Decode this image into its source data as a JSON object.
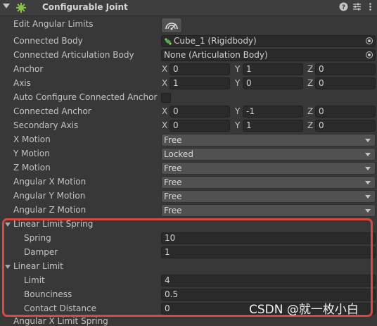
{
  "component": {
    "title": "Configurable Joint",
    "icons": [
      "help-icon",
      "preset-icon",
      "more-options-icon"
    ]
  },
  "rows": {
    "edit_angular_limits": "Edit Angular Limits",
    "connected_body": {
      "label": "Connected Body",
      "value": "Cube_1 (Rigidbody)"
    },
    "connected_articulation_body": {
      "label": "Connected Articulation Body",
      "value": "None (Articulation Body)"
    },
    "anchor": {
      "label": "Anchor",
      "x": "0",
      "y": "1",
      "z": "0"
    },
    "axis": {
      "label": "Axis",
      "x": "1",
      "y": "0",
      "z": "0"
    },
    "auto_configure": {
      "label": "Auto Configure Connected Anchor",
      "checked": false
    },
    "connected_anchor": {
      "label": "Connected Anchor",
      "x": "0",
      "y": "-1",
      "z": "0"
    },
    "secondary_axis": {
      "label": "Secondary Axis",
      "x": "0",
      "y": "1",
      "z": "0"
    },
    "x_motion": {
      "label": "X Motion",
      "value": "Free"
    },
    "y_motion": {
      "label": "Y Motion",
      "value": "Locked"
    },
    "z_motion": {
      "label": "Z Motion",
      "value": "Free"
    },
    "angular_x_motion": {
      "label": "Angular X Motion",
      "value": "Free"
    },
    "angular_y_motion": {
      "label": "Angular Y Motion",
      "value": "Free"
    },
    "angular_z_motion": {
      "label": "Angular Z Motion",
      "value": "Free"
    }
  },
  "axes": {
    "x": "X",
    "y": "Y",
    "z": "Z"
  },
  "linear_limit_spring": {
    "label": "Linear Limit Spring",
    "spring": {
      "label": "Spring",
      "value": "10"
    },
    "damper": {
      "label": "Damper",
      "value": "1"
    }
  },
  "linear_limit": {
    "label": "Linear Limit",
    "limit": {
      "label": "Limit",
      "value": "4"
    },
    "bounciness": {
      "label": "Bounciness",
      "value": "0.5"
    },
    "contact_distance": {
      "label": "Contact Distance",
      "value": "0"
    }
  },
  "next_row_partial": "Angular X Limit Spring",
  "watermark": "CSDN @就一枚小白",
  "colors": {
    "highlight": "#d9493f",
    "background": "#383838",
    "field": "#2a2a2a",
    "dropdown": "#515151"
  }
}
